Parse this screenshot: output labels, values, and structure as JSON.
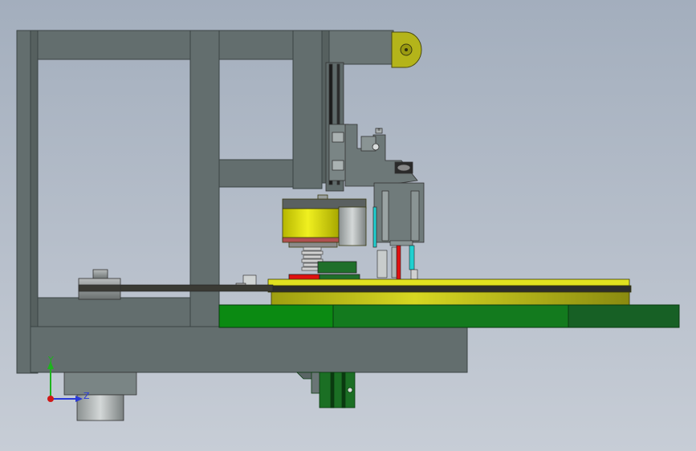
{
  "triad": {
    "y_label": "Y",
    "z_label": "Z",
    "y_color": "#1db31d",
    "z_color": "#2a3ad8",
    "x_color": "#d01818"
  },
  "colors": {
    "background_top": "#a3aebd",
    "background_bottom": "#c7cdd6",
    "frame": "#636e6e",
    "frame_dark": "#4a5353",
    "table_green": "#0b8a12",
    "table_green_dark": "#176025",
    "turntable_yellow": "#c8c814",
    "motor_yellow": "#e2e20a",
    "spring": "#c0c0c0",
    "red_part": "#e01010",
    "cyan_part": "#20d0d0",
    "bracket_olive": "#b4b41a"
  },
  "annotations": {
    "cylinder_tag": "≡"
  }
}
